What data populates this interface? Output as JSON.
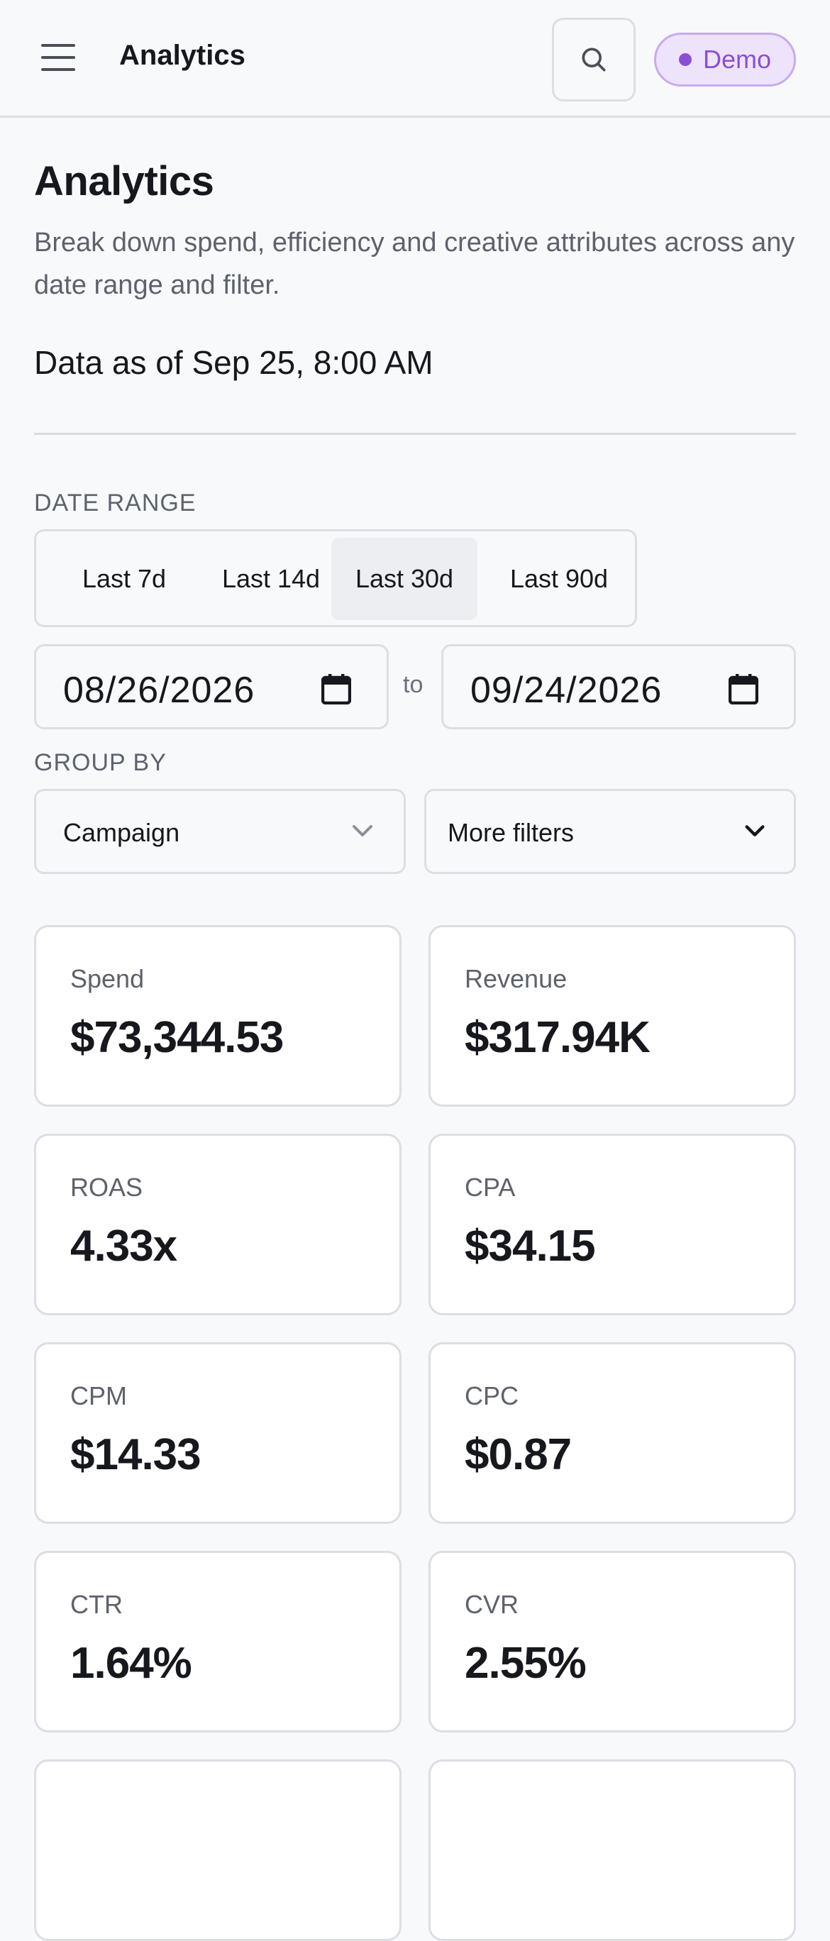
{
  "app_bar": {
    "title": "Analytics",
    "badge_label": "Demo",
    "icons": {
      "menu": "menu-icon",
      "search": "search-icon"
    }
  },
  "header": {
    "title": "Analytics",
    "description": "Break down spend, efficiency and creative attributes across any date range and filter.",
    "data_as_of": "Data as of Sep 25, 8:00 AM"
  },
  "filters": {
    "date_range_label": "DATE RANGE",
    "presets": [
      "Last 7d",
      "Last 14d",
      "Last 30d",
      "Last 90d"
    ],
    "active_preset": "Last 30d",
    "start_date": "08/26/2026",
    "end_date": "09/24/2026",
    "to_label": "to",
    "group_by_label": "GROUP BY",
    "group_by_value": "Campaign",
    "more_filters_label": "More filters"
  },
  "metrics": [
    {
      "label": "Spend",
      "value": "$73,344.53"
    },
    {
      "label": "Revenue",
      "value": "$317.94K"
    },
    {
      "label": "ROAS",
      "value": "4.33x"
    },
    {
      "label": "CPA",
      "value": "$34.15"
    },
    {
      "label": "CPM",
      "value": "$14.33"
    },
    {
      "label": "CPC",
      "value": "$0.87"
    },
    {
      "label": "CTR",
      "value": "1.64%"
    },
    {
      "label": "CVR",
      "value": "2.55%"
    }
  ],
  "colors": {
    "accent_purple": "#8a4fd6",
    "badge_bg": "#ede3fb",
    "border": "#dcdee3",
    "muted_text": "#5d626c"
  }
}
